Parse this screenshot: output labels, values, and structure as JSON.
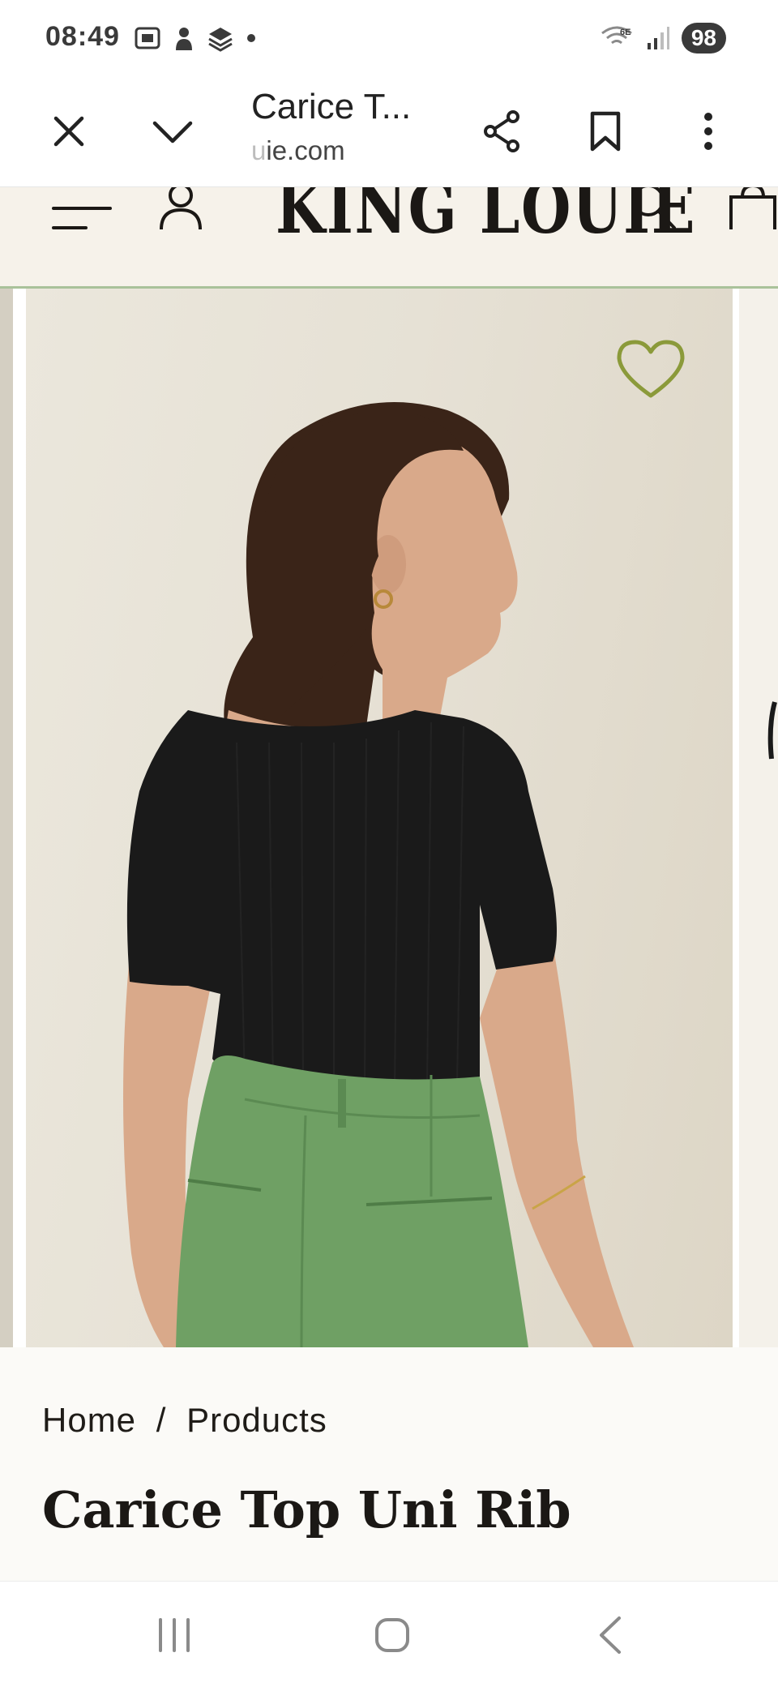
{
  "status_bar": {
    "time": "08:49",
    "battery": "98",
    "network_label": "6E",
    "left_icons": [
      "screenshot-icon",
      "bixby-icon",
      "stack-icon",
      "dot-icon"
    ],
    "right_icons": [
      "wifi-icon",
      "signal-icon",
      "battery-icon"
    ]
  },
  "browser": {
    "title": "Carice T...",
    "url_fade": "u",
    "url": "ie.com",
    "icons": [
      "close-icon",
      "chevron-down-icon",
      "share-icon",
      "bookmark-icon",
      "more-icon"
    ]
  },
  "site_header": {
    "logo": "KING LOUIE",
    "icons": [
      "menu-icon",
      "account-icon",
      "search-icon",
      "cart-icon"
    ]
  },
  "gallery": {
    "wishlist_icon": "heart-icon",
    "colors": {
      "background": "#e6e1d5",
      "top": "#1a1a1a",
      "trousers": "#6fa064",
      "skin": "#d9a98a",
      "hair": "#3a2418",
      "heart": "#8b9a3a"
    }
  },
  "product": {
    "breadcrumb_home": "Home",
    "breadcrumb_sep": "/",
    "breadcrumb_products": "Products",
    "title": "Carice Top Uni Rib"
  },
  "nav_bar": {
    "icons": [
      "recents-icon",
      "home-icon",
      "back-icon"
    ]
  }
}
